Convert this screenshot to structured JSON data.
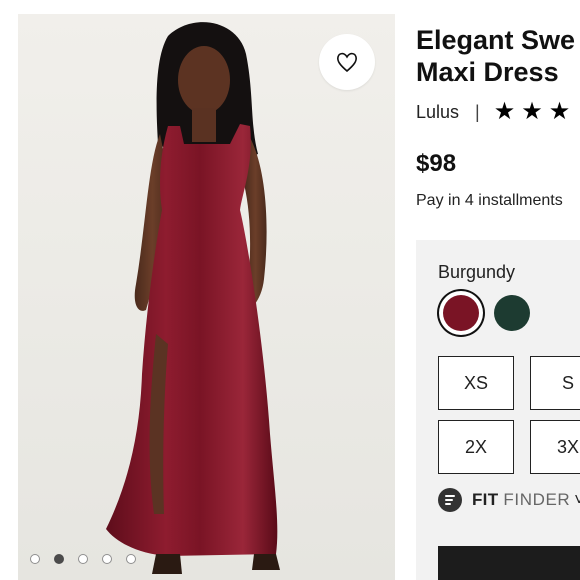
{
  "product": {
    "title": "Elegant Sweetheart Burgundy Velvet Maxi Dress",
    "title_visible": "Elegant Swe\nMaxi Dress",
    "brand": "Lulus",
    "separator": "|",
    "rating_stars_visible": 3,
    "price": "$98",
    "installments": "Pay in 4 installments"
  },
  "gallery": {
    "total_images": 5,
    "active_index": 1,
    "wishlist_icon": "heart-outline-icon"
  },
  "options": {
    "selected_color_label": "Burgundy",
    "colors": [
      {
        "name": "Burgundy",
        "hex": "#7a1425",
        "selected": true
      },
      {
        "name": "Dark Green",
        "hex": "#1d3b31",
        "selected": false
      }
    ],
    "sizes": [
      "XS",
      "S",
      "2X",
      "3X"
    ],
    "fit_finder": {
      "bold": "FIT",
      "light": "FINDER",
      "caret": "˅"
    }
  },
  "colors": {
    "panel_bg": "#f2f2f2",
    "dress": "#7a1425",
    "text": "#111111"
  }
}
